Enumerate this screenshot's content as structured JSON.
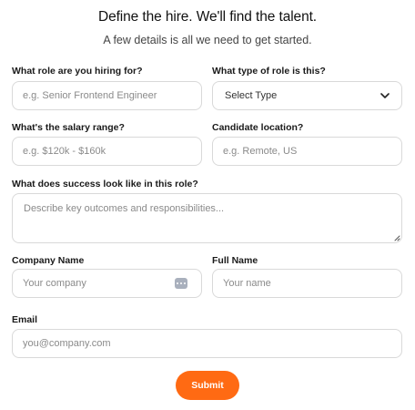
{
  "header": {
    "title": "Define the hire. We'll find the talent.",
    "subtitle": "A few details is all we need to get started."
  },
  "form": {
    "role": {
      "label": "What role are you hiring for?",
      "placeholder": "e.g. Senior Frontend Engineer",
      "value": ""
    },
    "role_type": {
      "label": "What type of role is this?",
      "selected": "Select Type"
    },
    "salary": {
      "label": "What's the salary range?",
      "placeholder": "e.g. $120k - $160k",
      "value": ""
    },
    "location": {
      "label": "Candidate location?",
      "placeholder": "e.g. Remote, US",
      "value": ""
    },
    "success": {
      "label": "What does success look like in this role?",
      "placeholder": "Describe key outcomes and responsibilities...",
      "value": ""
    },
    "company": {
      "label": "Company Name",
      "placeholder": "Your company",
      "value": ""
    },
    "full_name": {
      "label": "Full Name",
      "placeholder": "Your name",
      "value": ""
    },
    "email": {
      "label": "Email",
      "placeholder": "you@company.com",
      "value": ""
    },
    "submit_label": "Submit"
  },
  "colors": {
    "accent": "#ff6a13",
    "border": "#d9d9d9",
    "placeholder": "#8a8a8a"
  },
  "icons": {
    "select_arrow": "chevron-down-icon",
    "autofill": "autofill-dots-icon",
    "textarea_resize": "resize-grip-icon"
  }
}
